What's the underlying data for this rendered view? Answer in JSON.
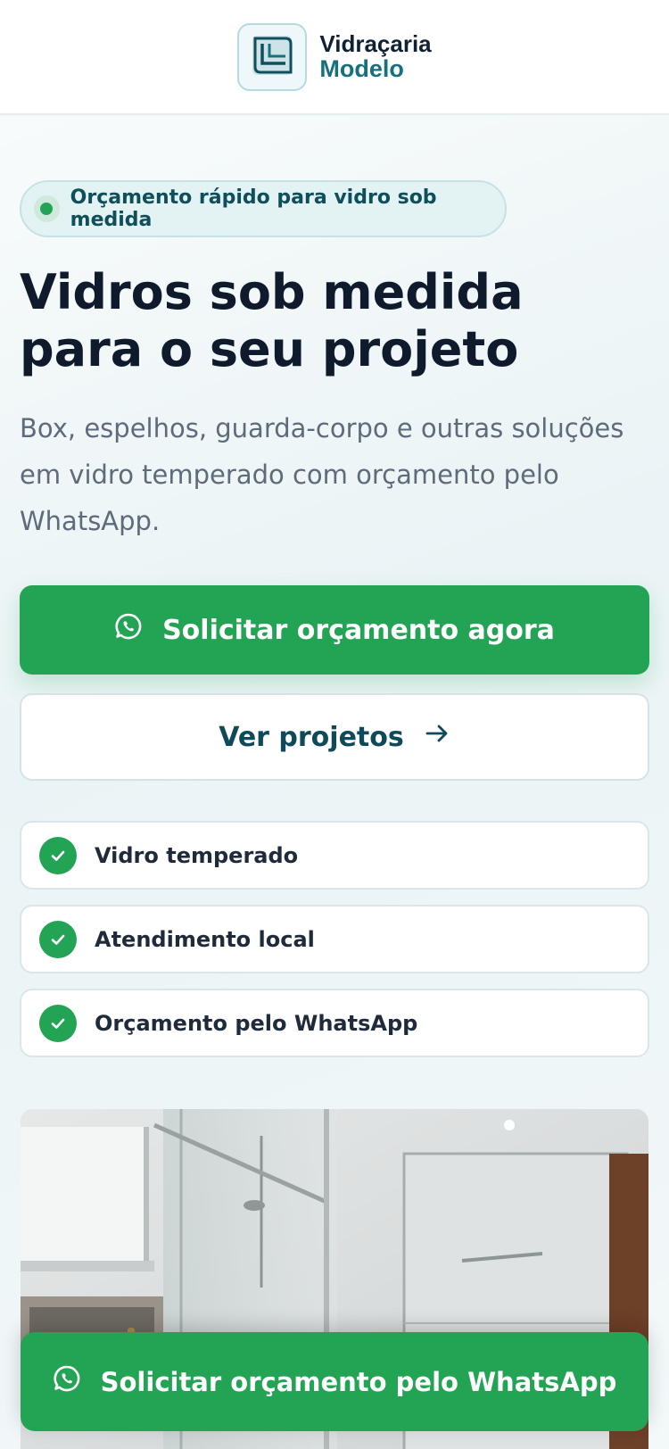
{
  "header": {
    "brand_line1": "Vidraçaria",
    "brand_line2": "Modelo",
    "logo_icon": "glass-corner-logo-icon"
  },
  "hero": {
    "badge_text": "Orçamento rápido para vidro sob medida",
    "title_line1": "Vidros sob medida",
    "title_line2": "para o seu projeto",
    "description": "Box, espelhos, guarda-corpo e outras soluções em vidro temperado com orçamento pelo WhatsApp.",
    "primary_button_label": "Solicitar orçamento agora",
    "secondary_button_label": "Ver projetos"
  },
  "features": [
    {
      "label": "Vidro temperado",
      "icon": "check-icon"
    },
    {
      "label": "Atendimento local",
      "icon": "check-icon"
    },
    {
      "label": "Orçamento pelo WhatsApp",
      "icon": "check-icon"
    }
  ],
  "sticky_cta": {
    "label": "Solicitar orçamento pelo WhatsApp",
    "icon": "whatsapp-icon"
  },
  "colors": {
    "accent_green": "#23a455",
    "brand_teal": "#17707e",
    "heading_dark": "#0f1b2d"
  }
}
